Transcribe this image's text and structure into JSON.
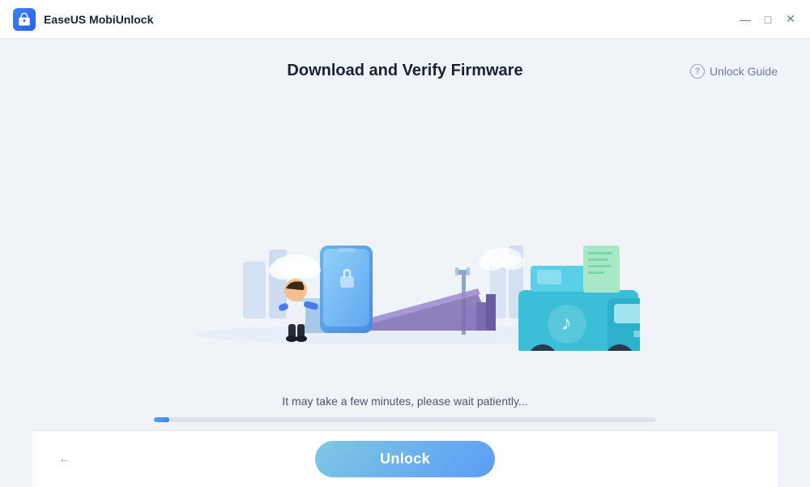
{
  "app": {
    "title": "EaseUS MobiUnlock",
    "icon_label": "lock-icon"
  },
  "titlebar": {
    "minimize_label": "—",
    "maximize_label": "□",
    "close_label": "✕"
  },
  "header": {
    "page_title": "Download and Verify Firmware",
    "unlock_guide_label": "Unlock Guide",
    "help_symbol": "?"
  },
  "progress": {
    "status_text": "It may take a few minutes, please wait patiently...",
    "percent": 3
  },
  "footer": {
    "unlock_button_label": "Unlock",
    "back_arrow": "←"
  }
}
